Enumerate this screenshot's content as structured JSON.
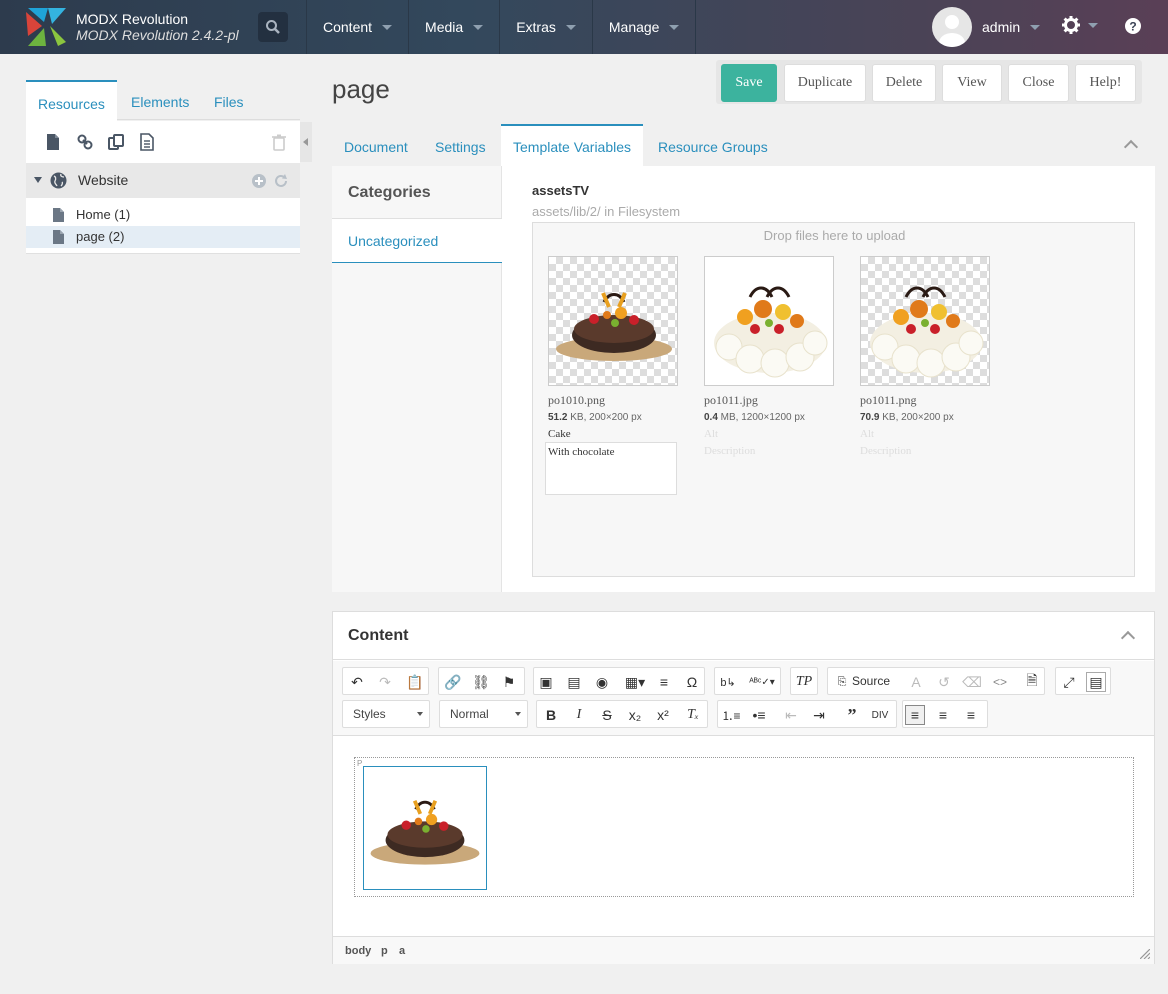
{
  "app": {
    "brand_name": "MODX Revolution",
    "brand_version": "MODX Revolution 2.4.2-pl",
    "nav": [
      {
        "label": "Content"
      },
      {
        "label": "Media"
      },
      {
        "label": "Extras"
      },
      {
        "label": "Manage"
      }
    ],
    "user": "admin",
    "icons": {
      "search": "search-icon",
      "gear": "gear-icon",
      "help": "help-icon"
    }
  },
  "left_panel": {
    "tabs": [
      {
        "label": "Resources",
        "active": true
      },
      {
        "label": "Elements"
      },
      {
        "label": "Files"
      }
    ],
    "website_label": "Website",
    "tree": [
      {
        "label": "Home (1)"
      },
      {
        "label": "page (2)",
        "selected": true
      }
    ]
  },
  "page": {
    "title": "page",
    "actions": {
      "save": "Save",
      "duplicate": "Duplicate",
      "delete": "Delete",
      "view": "View",
      "close": "Close",
      "help": "Help!"
    },
    "tabs": [
      {
        "label": "Document"
      },
      {
        "label": "Settings"
      },
      {
        "label": "Template Variables",
        "active": true
      },
      {
        "label": "Resource Groups"
      }
    ]
  },
  "tv_panel": {
    "categories_heading": "Categories",
    "category": "Uncategorized",
    "tv_name": "assetsTV",
    "tv_description": "assets/lib/2/ in Filesystem",
    "dropzone_text": "Drop files here to upload",
    "files": [
      {
        "name": "po1010.png",
        "size": "51.2",
        "size_unit": " KB, 200×200 px",
        "alt": "Cake",
        "description": "With chocolate"
      },
      {
        "name": "po1011.jpg",
        "size": "0.4",
        "size_unit": " MB, 1200×1200 px",
        "alt_placeholder": "Alt",
        "description_placeholder": "Description"
      },
      {
        "name": "po1011.png",
        "size": "70.9",
        "size_unit": " KB, 200×200 px",
        "alt_placeholder": "Alt",
        "description_placeholder": "Description"
      }
    ]
  },
  "content_editor": {
    "heading": "Content",
    "styles_select": "Styles",
    "format_select": "Normal",
    "source_label": "Source",
    "path": [
      "body",
      "p",
      "a"
    ],
    "para_marker": "P"
  },
  "colors": {
    "accent": "#2a8fbd",
    "save": "#3cb39e"
  }
}
